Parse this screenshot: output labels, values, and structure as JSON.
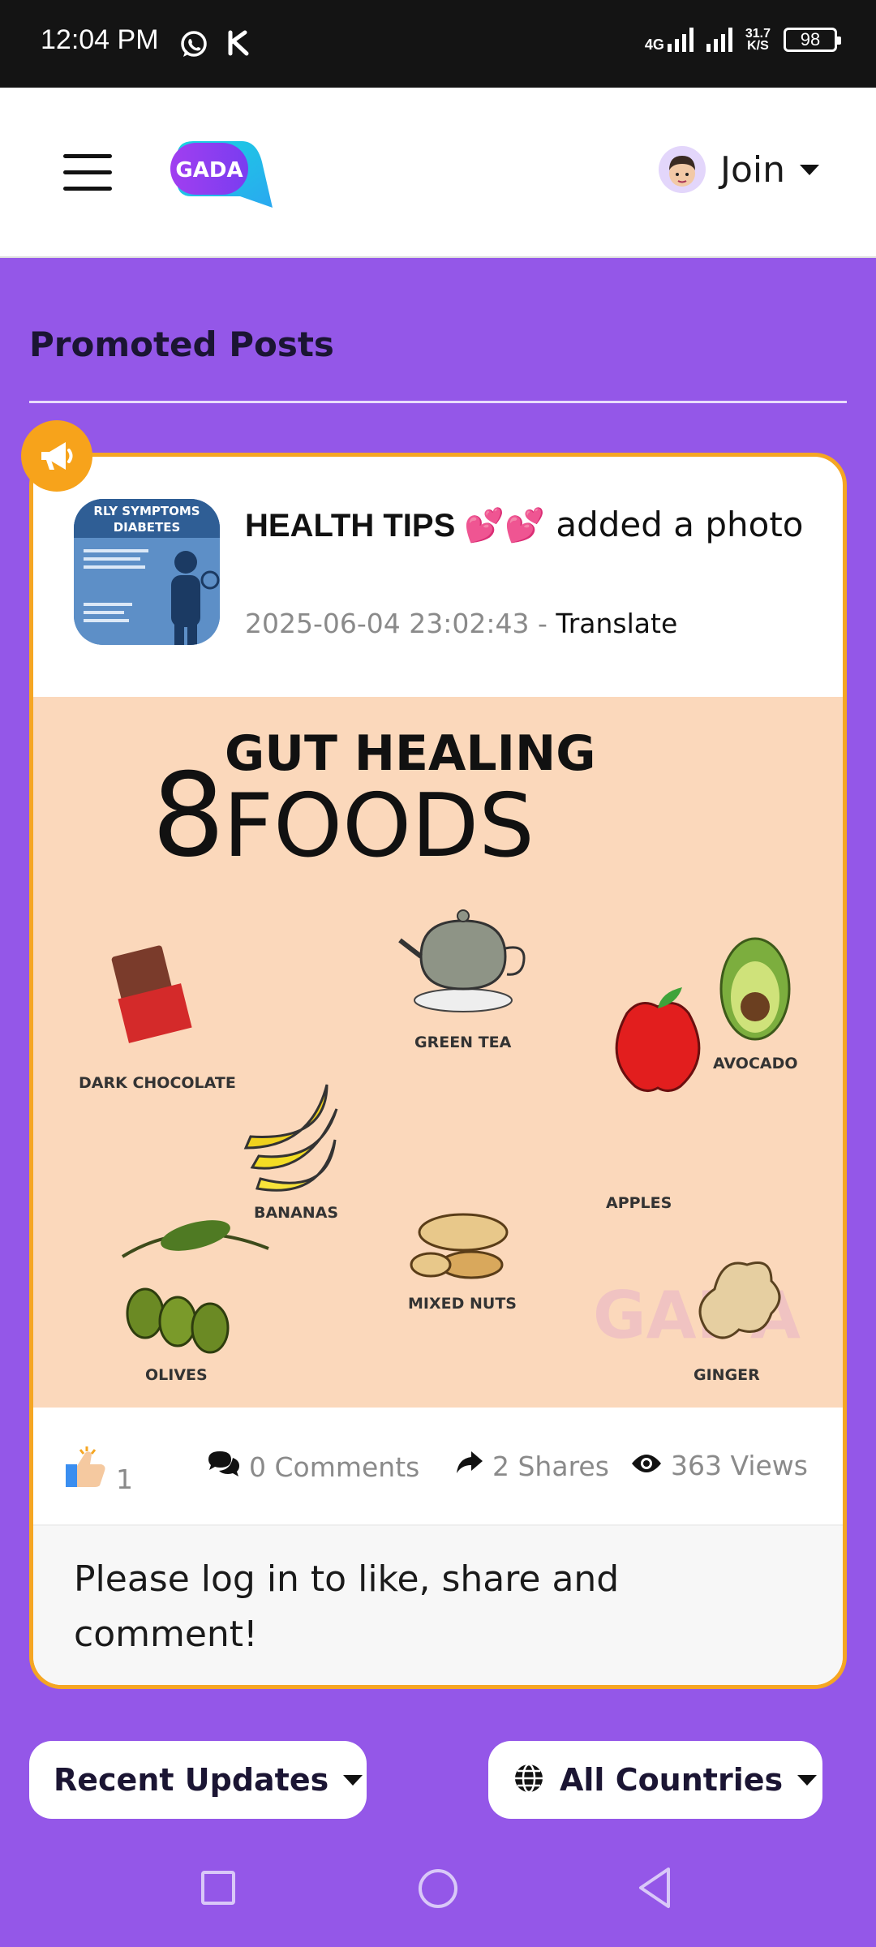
{
  "status_bar": {
    "time": "12:04 PM",
    "network_type": "4G",
    "speed_value": "31.7",
    "speed_unit": "K/S",
    "battery": "98"
  },
  "app_bar": {
    "logo_text": "GADA",
    "join_label": "Join"
  },
  "section": {
    "title": "Promoted Posts"
  },
  "post": {
    "author": "HEALTH TIPS 💕💕",
    "action_text": "added a photo",
    "timestamp": "2025-06-04 23:02:43",
    "separator": "-",
    "translate_label": "Translate",
    "thumbnail_text": {
      "line1": "RLY SYMPTOMS",
      "line2": "DIABETES"
    },
    "image": {
      "number": "8",
      "heading_top": "GUT HEALING",
      "heading_bottom": "FOODS",
      "items": [
        "DARK CHOCOLATE",
        "GREEN TEA",
        "AVOCADO",
        "BANANAS",
        "APPLES",
        "MIXED NUTS",
        "OLIVES",
        "GINGER"
      ],
      "watermark": "GADA"
    },
    "stats": {
      "likes": "1",
      "comments": "0 Comments",
      "shares": "2 Shares",
      "views": "363 Views"
    },
    "login_prompt": "Please log in to like, share and comment!"
  },
  "filters": {
    "updates_label": "Recent Updates",
    "countries_label": "All Countries"
  },
  "colors": {
    "background": "#9457e8",
    "promo_accent": "#f5a623",
    "text_dark": "#1b1533"
  },
  "icons": [
    "whatsapp-icon",
    "k-app-icon",
    "menu-icon",
    "megaphone-icon",
    "comments-icon",
    "share-icon",
    "eye-icon",
    "globe-icon",
    "thumbs-up-icon"
  ]
}
